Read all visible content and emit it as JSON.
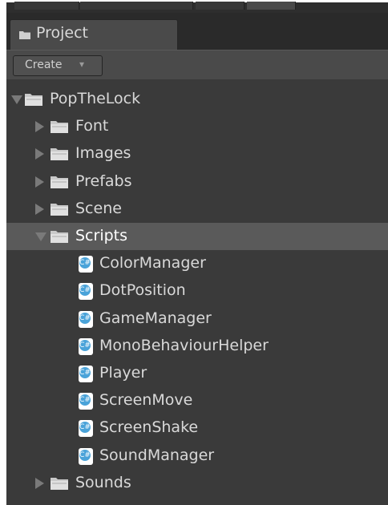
{
  "panel": {
    "tab_label": "Project",
    "create_label": "Create",
    "create_arrow": "▾"
  },
  "tree": {
    "root": {
      "label": "PopTheLock",
      "expanded": true
    },
    "folders": [
      {
        "label": "Font",
        "expanded": false
      },
      {
        "label": "Images",
        "expanded": false
      },
      {
        "label": "Prefabs",
        "expanded": false
      },
      {
        "label": "Scene",
        "expanded": false
      },
      {
        "label": "Scripts",
        "expanded": true,
        "selected": true
      },
      {
        "label": "Sounds",
        "expanded": false
      }
    ],
    "scripts": [
      "ColorManager",
      "DotPosition",
      "GameManager",
      "MonoBehaviourHelper",
      "Player",
      "ScreenMove",
      "ScreenShake",
      "SoundManager"
    ]
  },
  "icons": {
    "folder": "folder-icon",
    "script": "csharp-script-icon",
    "cs_glyph": "C#"
  },
  "colors": {
    "panel_bg": "#3a3a3a",
    "selection": "#5a5a5a",
    "text": "#d9d9d9",
    "script_icon": "#4aa3d9"
  }
}
